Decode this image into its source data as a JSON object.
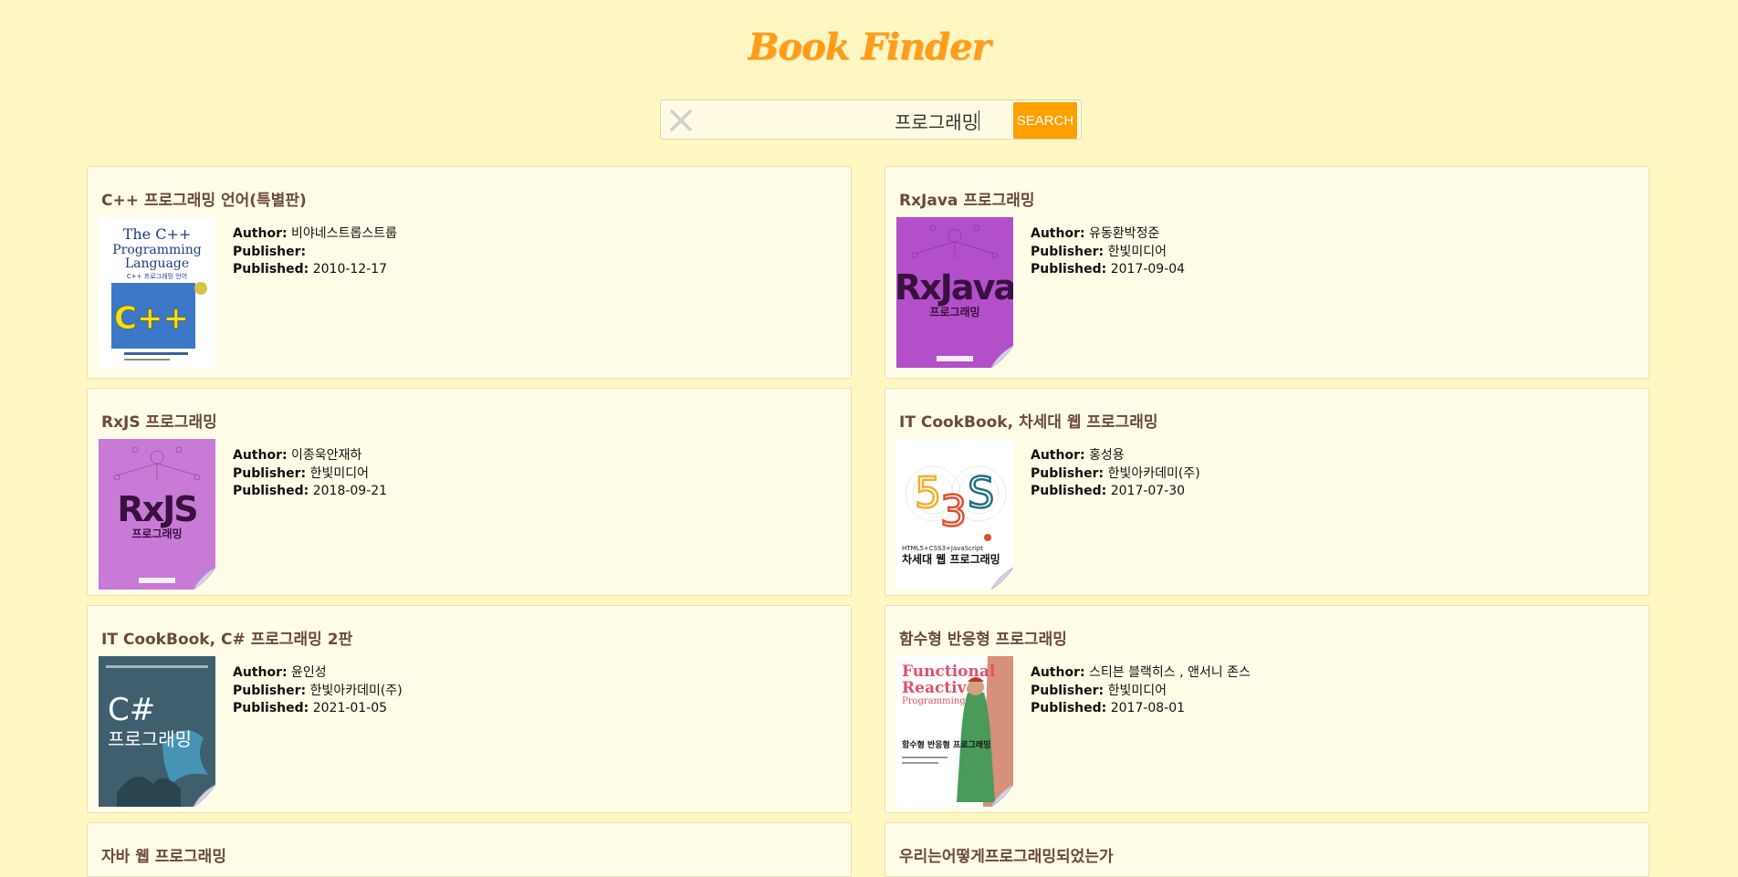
{
  "app": {
    "title": "Book Finder"
  },
  "search": {
    "value": "프로그래밍",
    "button_label": "SEARCH"
  },
  "labels": {
    "author": "Author:",
    "publisher": "Publisher:",
    "published": "Published:"
  },
  "books": [
    {
      "title": "C++ 프로그래밍 언어(특별판)",
      "author": "비야네스트롭스트룹",
      "publisher": "",
      "published": "2010-12-17",
      "cover": {
        "bg": "#ffffff",
        "style": "cpp",
        "text1": "The C++",
        "text2": "Programming",
        "text3": "Language",
        "text4": "C++ 프로그래밍 언어"
      }
    },
    {
      "title": "RxJava 프로그래밍",
      "author": "유동환박정준",
      "publisher": "한빛미디어",
      "published": "2017-09-04",
      "cover": {
        "bg": "#b24fc9",
        "style": "rx",
        "text1": "RxJava",
        "text2": "프로그래밍"
      }
    },
    {
      "title": "RxJS 프로그래밍",
      "author": "이종욱안재하",
      "publisher": "한빛미디어",
      "published": "2018-09-21",
      "cover": {
        "bg": "#c77ad6",
        "style": "rx",
        "text1": "RxJS",
        "text2": "프로그래밍"
      }
    },
    {
      "title": "IT CookBook, 차세대 웹 프로그래밍",
      "author": "홍성용",
      "publisher": "한빛아카데미(주)",
      "published": "2017-07-30",
      "cover": {
        "bg": "#ffffff",
        "style": "web",
        "text1": "5 3 S",
        "text2": "HTML5+CSS3+JavaScript",
        "text3": "차세대 웹 프로그래밍"
      }
    },
    {
      "title": "IT CookBook, C# 프로그래밍 2판",
      "author": "윤인성",
      "publisher": "한빛아카데미(주)",
      "published": "2021-01-05",
      "cover": {
        "bg": "#3f5f6e",
        "style": "csharp",
        "text1": "C#",
        "text2": "프로그래밍"
      }
    },
    {
      "title": "함수형 반응형 프로그래밍",
      "author": "스티븐 블랙히스 , 앤서니 존스",
      "publisher": "한빛미디어",
      "published": "2017-08-01",
      "cover": {
        "bg": "#ffffff",
        "style": "frp",
        "text1": "Functional",
        "text2": "Reactive",
        "text3": "Programming",
        "text4": "함수형 반응형 프로그래밍"
      }
    },
    {
      "title": "자바 웹 프로그래밍",
      "author": "",
      "publisher": "",
      "published": "",
      "cover": {
        "bg": "#ffffff",
        "style": "none"
      }
    },
    {
      "title": "우리는어떻게프로그래밍되었는가",
      "author": "",
      "publisher": "",
      "published": "",
      "cover": {
        "bg": "#ffffff",
        "style": "none"
      }
    }
  ],
  "colors": {
    "background": "#fff7c2",
    "accent": "#ffa000",
    "card_bg": "#fffde8",
    "title_color": "#ff9c1a"
  },
  "icons": {
    "clear": "close-icon"
  }
}
